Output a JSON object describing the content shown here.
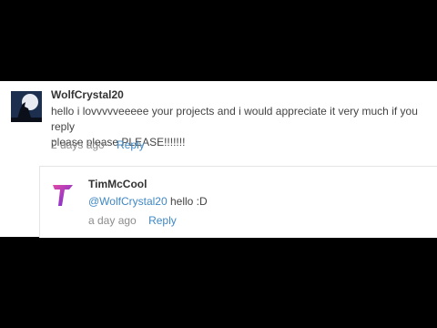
{
  "comments": [
    {
      "author": "WolfCrystal20",
      "text_line1": "hello i lovvvvveeeee your projects and i would appreciate it very much if you reply",
      "text_line2": "please please PLEASE!!!!!!!",
      "time": "2 days ago",
      "reply_label": "Reply",
      "avatar_icon": "howling-wolf-moon"
    },
    {
      "author": "TimMcCool",
      "mention": "@WolfCrystal20",
      "text": " hello :D",
      "time": "a day ago",
      "reply_label": "Reply",
      "avatar_icon": "purple-pink-gradient-logo"
    }
  ],
  "colors": {
    "link": "#3f88c5",
    "meta": "#8c8c8c",
    "background_outer": "#000000"
  }
}
